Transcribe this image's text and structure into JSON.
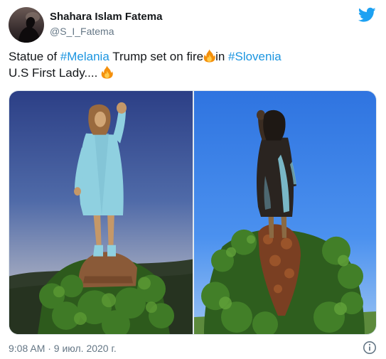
{
  "author": {
    "display_name": "Shahara Islam Fatema",
    "handle": "@S_I_Fatema"
  },
  "tweet": {
    "line1_prefix": "Statue of ",
    "line1_hashtag1": "#Melania",
    "line1_middle": " Trump set on fire",
    "line1_after_fire": "in ",
    "line1_hashtag2": "#Slovenia",
    "line2_text": "U.S First Lady.... "
  },
  "icons": {
    "brand": "twitter-bird-icon",
    "emoji": "fire-emoji",
    "info": "info-icon"
  },
  "colors": {
    "hashtag": "#1b95e0",
    "brand": "#1da1f2",
    "muted": "#657786"
  },
  "timestamp": "9:08 AM · 9 июл. 2020 г."
}
